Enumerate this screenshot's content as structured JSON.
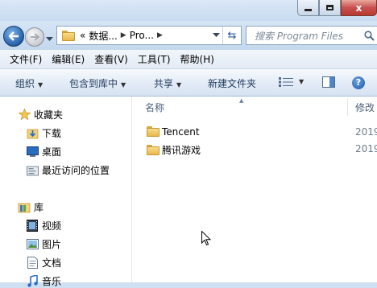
{
  "window": {
    "min_label": "",
    "max_label": "",
    "close_label": "x"
  },
  "address": {
    "overflow": "«",
    "crumbs": [
      "数据...",
      "Pro..."
    ],
    "sep": "▶",
    "refresh": "⇆"
  },
  "search": {
    "placeholder": "搜索 Program Files"
  },
  "menu": {
    "file": "文件(F)",
    "edit": "编辑(E)",
    "view": "查看(V)",
    "tools": "工具(T)",
    "help": "帮助(H)"
  },
  "commands": {
    "organize": "组织",
    "include_library": "包含到库中",
    "share": "共享",
    "new_folder": "新建文件夹",
    "help_glyph": "?"
  },
  "nav": {
    "favorites": "收藏夹",
    "downloads": "下载",
    "desktop": "桌面",
    "recent": "最近访问的位置",
    "libraries": "库",
    "videos": "视频",
    "pictures": "图片",
    "documents": "文档",
    "music": "音乐"
  },
  "columns": {
    "name": "名称",
    "modified": "修改"
  },
  "files": [
    {
      "name": "Tencent",
      "date": "2019"
    },
    {
      "name": "腾讯游戏",
      "date": "2019"
    }
  ],
  "colors": {
    "accent": "#1d57a6",
    "folder": "#e8b94a",
    "close": "#c75050"
  }
}
